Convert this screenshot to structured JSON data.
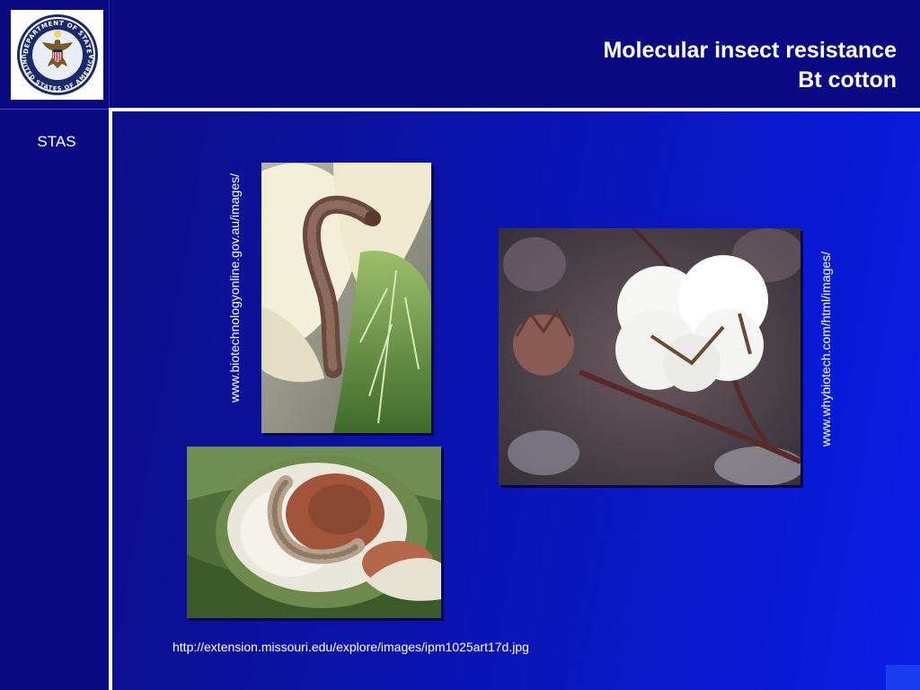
{
  "slide": {
    "title_line1": "Molecular insect resistance",
    "title_line2": "Bt cotton",
    "sidebar_label": "STAS"
  },
  "seal": {
    "text_top": "DEPARTMENT OF STATE",
    "text_bottom": "UNITED STATES OF AMERICA"
  },
  "images": [
    {
      "subject": "caterpillar-on-cotton-flower",
      "caption": "www.biotechnologyonline.gov.au/images/"
    },
    {
      "subject": "open-cotton-boll",
      "caption": "www.whybiotech.com/html/images/"
    },
    {
      "subject": "bollworm-in-cotton-boll",
      "caption": "http://extension.missouri.edu/explore/images/ipm1025art17d.jpg"
    }
  ],
  "colors": {
    "header_bg": "#0a0a82",
    "slide_bg_start": "#0c0f7a",
    "slide_bg_end": "#0a1ee6",
    "accent_line": "#ffffff"
  }
}
